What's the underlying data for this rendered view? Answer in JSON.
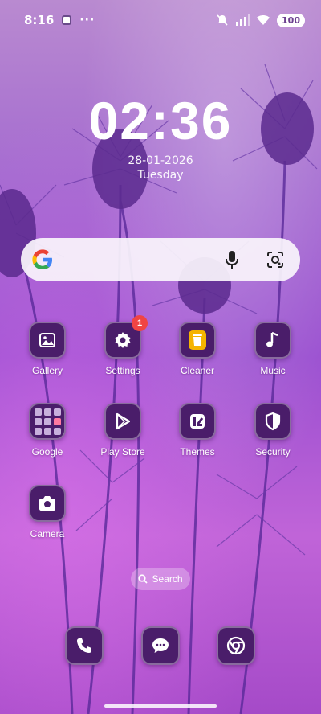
{
  "status_bar": {
    "time": "8:16",
    "more": "···",
    "battery": "100"
  },
  "clock": {
    "time": "02:36",
    "date": "28-01-2026",
    "day": "Tuesday"
  },
  "apps": [
    {
      "label": "Gallery",
      "icon": "gallery-icon"
    },
    {
      "label": "Settings",
      "icon": "gear-icon",
      "badge": "1"
    },
    {
      "label": "Cleaner",
      "icon": "trash-icon"
    },
    {
      "label": "Music",
      "icon": "music-note-icon"
    },
    {
      "label": "Google",
      "icon": "folder-icon"
    },
    {
      "label": "Play Store",
      "icon": "play-icon"
    },
    {
      "label": "Themes",
      "icon": "themes-icon"
    },
    {
      "label": "Security",
      "icon": "shield-icon"
    },
    {
      "label": "Camera",
      "icon": "camera-icon"
    }
  ],
  "home_search": {
    "label": "Search"
  },
  "dock": [
    {
      "icon": "phone-icon"
    },
    {
      "icon": "message-icon"
    },
    {
      "icon": "chrome-icon"
    }
  ],
  "colors": {
    "icon_bg": "#4a1d6a",
    "badge": "#f04444",
    "cleaner_accent": "#f5b400"
  }
}
